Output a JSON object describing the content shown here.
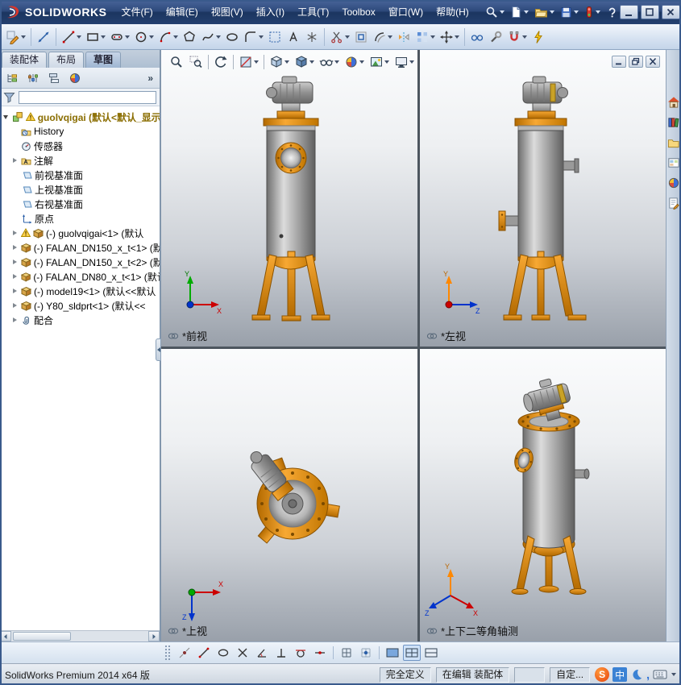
{
  "titlebar": {
    "app_name": "SOLIDWORKS",
    "menus": [
      "文件(F)",
      "编辑(E)",
      "视图(V)",
      "插入(I)",
      "工具(T)",
      "Toolbox",
      "窗口(W)",
      "帮助(H)"
    ],
    "quick_icons": [
      "search",
      "new-document",
      "open",
      "save",
      "rebuild",
      "help"
    ],
    "window_buttons": [
      "minimize",
      "maximize",
      "close"
    ]
  },
  "sketch_toolbar": {
    "icons": [
      "sketch",
      "smart-dimension",
      "line",
      "rectangle",
      "slot",
      "circle",
      "arc",
      "polygon",
      "spline",
      "ellipse",
      "fillet",
      "construction-frame",
      "text",
      "point",
      "trim",
      "convert-entities",
      "offset",
      "mirror",
      "linear-pattern",
      "move",
      "display-relations",
      "repair-sketch",
      "quick-snaps",
      "rapid-sketch"
    ]
  },
  "command_tabs": [
    {
      "label": "装配体"
    },
    {
      "label": "布局"
    },
    {
      "label": "草图"
    }
  ],
  "panel": {
    "overflow_glyph": "»",
    "tab_icons": [
      "featuremanager",
      "propertymanager",
      "configurationmanager",
      "displaymanager"
    ],
    "filter_value": ""
  },
  "feature_tree": {
    "root": {
      "label": "guolvqigai (默认<默认_显示"
    },
    "items": [
      {
        "label": "History"
      },
      {
        "label": "传感器"
      },
      {
        "label": "注解"
      },
      {
        "label": "前视基准面"
      },
      {
        "label": "上视基准面"
      },
      {
        "label": "右视基准面"
      },
      {
        "label": "原点"
      },
      {
        "label": "(-) guolvqigai<1> (默认"
      },
      {
        "label": "(-) FALAN_DN150_x_t<1> (默"
      },
      {
        "label": "(-) FALAN_DN150_x_t<2> (默"
      },
      {
        "label": "(-) FALAN_DN80_x_t<1> (默认"
      },
      {
        "label": "(-) model19<1> (默认<<默认"
      },
      {
        "label": "(-) Y80_sldprt<1> (默认<<"
      },
      {
        "label": "配合"
      }
    ]
  },
  "headsup_toolbar": {
    "icons": [
      "zoom-fit",
      "zoom-area",
      "previous-view",
      "section-view",
      "view-orientation",
      "display-style",
      "hide-show-items",
      "edit-appearance",
      "apply-scene",
      "view-settings"
    ]
  },
  "viewports": [
    {
      "label": "*前视"
    },
    {
      "label": "*左视"
    },
    {
      "label": "*上视"
    },
    {
      "label": "*上下二等角轴测"
    }
  ],
  "triad_labels": {
    "x": "X",
    "y": "Y",
    "z": "Z"
  },
  "task_pane": {
    "icons": [
      "solidworks-resources",
      "design-library",
      "file-explorer",
      "view-palette",
      "appearances",
      "custom-properties"
    ]
  },
  "snap_toolbar": {
    "icons": [
      "point-snap",
      "line-snap",
      "ellipse-snap",
      "intersection-snap",
      "angle-snap",
      "perpendicular-snap",
      "tangent-snap",
      "midpoint-snap",
      "grid-snap",
      "snap-options",
      "viewport-single",
      "viewport-four",
      "viewport-two-horizontal"
    ]
  },
  "statusbar": {
    "product": "SolidWorks Premium 2014 x64 版",
    "define_state": "完全定义",
    "editing_state": "在编辑 装配体",
    "custom": "自定...",
    "ime": {
      "sogou": "S",
      "cn": "中",
      "comma": ","
    }
  },
  "model": {
    "colors": {
      "body_gray": "#9a9a9a",
      "accent_orange": "#e8920a"
    }
  }
}
